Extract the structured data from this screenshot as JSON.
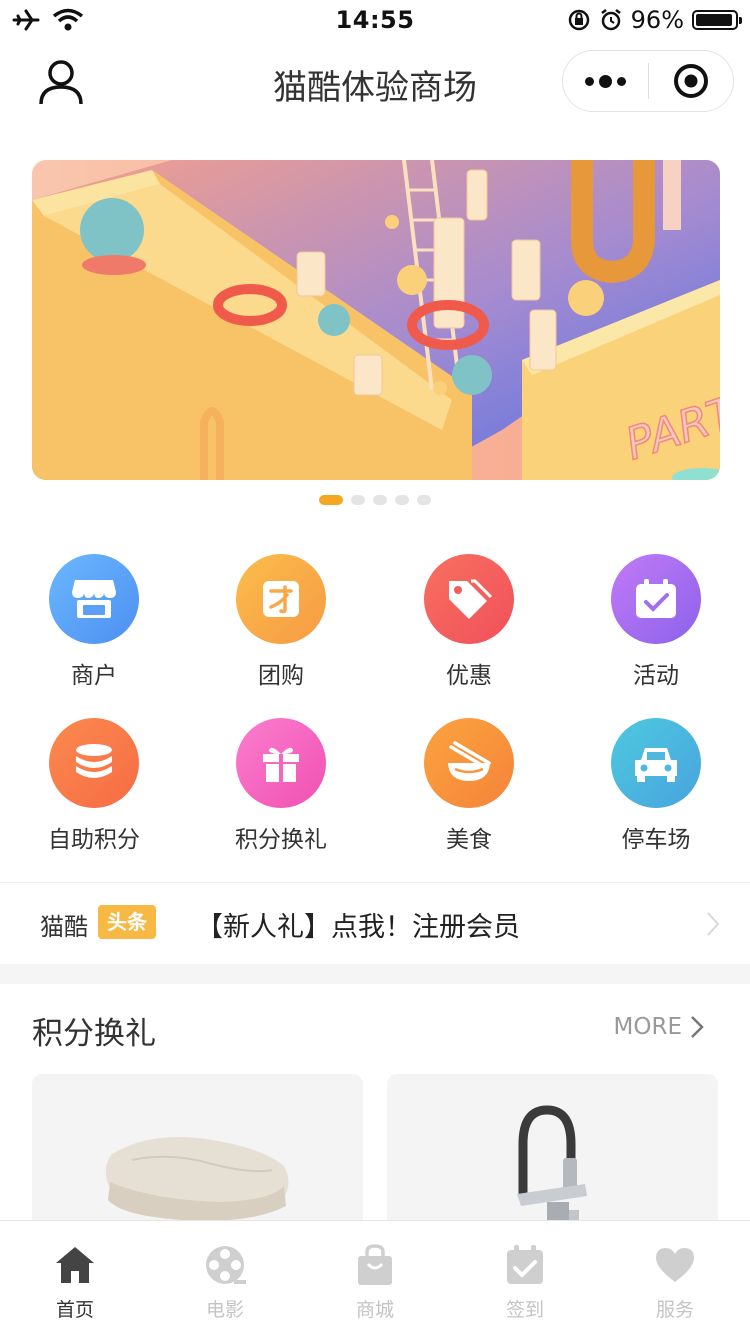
{
  "status_bar": {
    "time": "14:55",
    "battery": "96%",
    "battery_level": 0.96
  },
  "nav": {
    "title": "猫酷体验商场",
    "icons": [
      "user-icon",
      "more-dots-icon",
      "target-icon"
    ]
  },
  "banner": {
    "art_text": "PART",
    "slide_count": 5,
    "active_index": 0
  },
  "grid": [
    {
      "label": "商户",
      "icon": "store-icon",
      "color": "#5aa7f7"
    },
    {
      "label": "团购",
      "icon": "group-buy-icon",
      "color": "#f8a84a"
    },
    {
      "label": "优惠",
      "icon": "tag-icon",
      "color": "#f4615d"
    },
    {
      "label": "活动",
      "icon": "calendar-check-icon",
      "color": "#a86ff0"
    },
    {
      "label": "自助积分",
      "icon": "coins-stack-icon",
      "color": "#f97b4a"
    },
    {
      "label": "积分换礼",
      "icon": "gift-icon",
      "color": "#f660c0"
    },
    {
      "label": "美食",
      "icon": "bowl-chopsticks-icon",
      "color": "#f8953c"
    },
    {
      "label": "停车场",
      "icon": "car-icon",
      "color": "#4fb8e0"
    }
  ],
  "notice": {
    "brand": "猫酷",
    "badge": "头条",
    "text": "【新人礼】点我！注册会员"
  },
  "section": {
    "title": "积分换礼",
    "more": "MORE"
  },
  "tabbar": [
    {
      "label": "首页",
      "icon": "home-icon",
      "active": true
    },
    {
      "label": "电影",
      "icon": "film-reel-icon",
      "active": false
    },
    {
      "label": "商城",
      "icon": "shopping-bag-icon",
      "active": false
    },
    {
      "label": "签到",
      "icon": "check-in-icon",
      "active": false
    },
    {
      "label": "服务",
      "icon": "heart-icon",
      "active": false
    }
  ],
  "colors": {
    "accent": "#f5a623",
    "tab_active": "#333333",
    "tab_inactive": "#c4c4c4"
  }
}
